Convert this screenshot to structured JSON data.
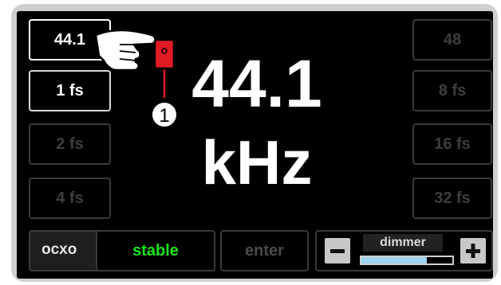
{
  "left_buttons": [
    {
      "label": "44.1",
      "state": "selected"
    },
    {
      "label": "1 fs",
      "state": "active"
    },
    {
      "label": "2 fs",
      "state": "dim"
    },
    {
      "label": "4 fs",
      "state": "dim"
    }
  ],
  "right_buttons": [
    {
      "label": "48",
      "state": "dim"
    },
    {
      "label": "8 fs",
      "state": "dim"
    },
    {
      "label": "16 fs",
      "state": "dim"
    },
    {
      "label": "32 fs",
      "state": "dim"
    }
  ],
  "display": {
    "value": "44.1",
    "unit": "kHz"
  },
  "callout": {
    "number": "1",
    "color": "#e01b24"
  },
  "ocxo": {
    "label": "ocxo",
    "status": "stable",
    "status_color": "#19e619"
  },
  "enter": {
    "label": "enter"
  },
  "dimmer": {
    "label": "dimmer",
    "minus_icon": "minus-icon",
    "plus_icon": "plus-icon",
    "level": 0.72,
    "fill_color": "#9fd4ee"
  }
}
